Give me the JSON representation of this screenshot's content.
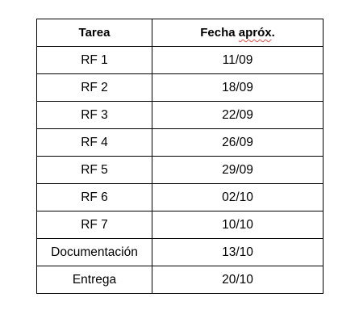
{
  "table": {
    "headers": {
      "task": "Tarea",
      "date_prefix": "Fecha ",
      "date_word": "apróx",
      "date_suffix": "."
    },
    "rows": [
      {
        "task": "RF 1",
        "date": "11/09"
      },
      {
        "task": "RF 2",
        "date": "18/09"
      },
      {
        "task": "RF 3",
        "date": "22/09"
      },
      {
        "task": "RF 4",
        "date": "26/09"
      },
      {
        "task": "RF 5",
        "date": "29/09"
      },
      {
        "task": "RF 6",
        "date": "02/10"
      },
      {
        "task": "RF 7",
        "date": "10/10"
      },
      {
        "task": "Documentación",
        "date": "13/10"
      },
      {
        "task": "Entrega",
        "date": "20/10"
      }
    ]
  }
}
